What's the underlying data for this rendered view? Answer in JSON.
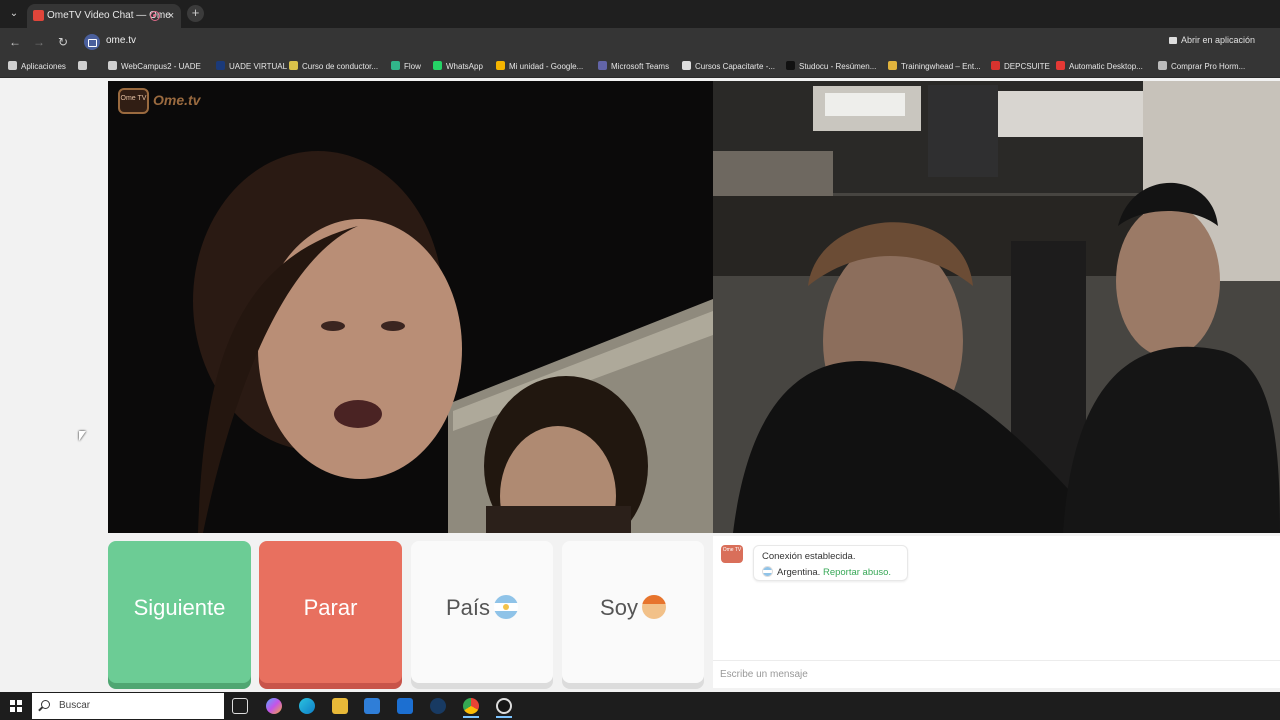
{
  "browser": {
    "tab_title": "OmeTV Video Chat — Ome",
    "tab_close": "×",
    "new_tab": "+",
    "url": "ome.tv",
    "open_app_label": "Abrir en aplicación"
  },
  "bookmarks": [
    {
      "label": "Aplicaciones",
      "icon": "apps-grid-icon",
      "color": "#cfcfcf"
    },
    {
      "label": "",
      "icon": "grid-icon",
      "color": "#cfcfcf"
    },
    {
      "label": "WebCampus2 - UADE",
      "icon": "globe-icon",
      "color": "#cfcfcf"
    },
    {
      "label": "UADE VIRTUAL",
      "icon": "uade-icon",
      "color": "#1b3a79"
    },
    {
      "label": "Curso de conductor...",
      "icon": "folder-icon",
      "color": "#d8c14a"
    },
    {
      "label": "Flow",
      "icon": "flow-icon",
      "color": "#31b58a"
    },
    {
      "label": "WhatsApp",
      "icon": "whatsapp-icon",
      "color": "#25d366"
    },
    {
      "label": "Mi unidad - Google...",
      "icon": "drive-icon",
      "color": "#f4b400"
    },
    {
      "label": "Microsoft Teams",
      "icon": "teams-icon",
      "color": "#6264a7"
    },
    {
      "label": "Cursos Capacitarte -...",
      "icon": "capacitarte-icon",
      "color": "#dddddd"
    },
    {
      "label": "Studocu - Resúmen...",
      "icon": "studocu-icon",
      "color": "#111111"
    },
    {
      "label": "Trainingwhead – Ent...",
      "icon": "trainingwhead-icon",
      "color": "#e0b33d"
    },
    {
      "label": "DEPCSUITE",
      "icon": "depcsuite-icon",
      "color": "#d7332e"
    },
    {
      "label": "Automatic Desktop...",
      "icon": "automatic-icon",
      "color": "#e53935"
    },
    {
      "label": "Comprar Pro Horm...",
      "icon": "shop-icon",
      "color": "#bbbbbb"
    }
  ],
  "logo": {
    "tv_text": "Ome TV",
    "text": "Ome.tv"
  },
  "controls": {
    "next": "Siguiente",
    "stop": "Parar",
    "country": "País",
    "me": "Soy"
  },
  "chat": {
    "logo_text": "Ome TV",
    "status": "Conexión establecida.",
    "country": "Argentina.",
    "report": "Reportar abuso.",
    "input_placeholder": "Escribe un mensaje"
  },
  "taskbar": {
    "search_placeholder": "Buscar",
    "apps": [
      "task-view-icon",
      "copilot-icon",
      "edge-icon",
      "explorer-icon",
      "store-icon",
      "outlook-icon",
      "steam-icon",
      "chrome-icon",
      "obs-icon"
    ]
  },
  "colors": {
    "next": "#6ccc95",
    "stop": "#e8705f",
    "report_link": "#38a857"
  }
}
